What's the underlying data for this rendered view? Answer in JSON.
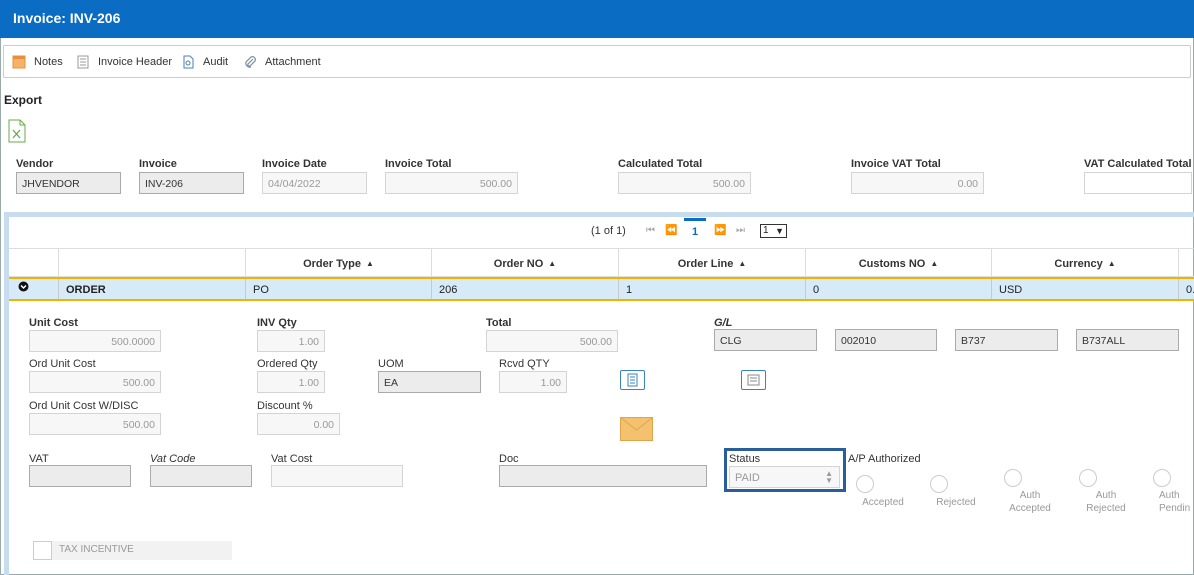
{
  "window": {
    "title": "Invoice: INV-206"
  },
  "toolbar": {
    "notes": "Notes",
    "invoice_header": "Invoice Header",
    "audit": "Audit",
    "attachment": "Attachment"
  },
  "export": {
    "label": "Export"
  },
  "header": {
    "vendor_label": "Vendor",
    "vendor_value": "JHVENDOR",
    "invoice_label": "Invoice",
    "invoice_value": "INV-206",
    "invoice_date_label": "Invoice Date",
    "invoice_date_value": "04/04/2022",
    "invoice_total_label": "Invoice Total",
    "invoice_total_value": "500.00",
    "calculated_total_label": "Calculated Total",
    "calculated_total_value": "500.00",
    "invoice_vat_total_label": "Invoice VAT Total",
    "invoice_vat_total_value": "0.00",
    "vat_calculated_total_label": "VAT Calculated Total",
    "vat_calculated_total_value": ""
  },
  "pager": {
    "summary": "(1 of 1)",
    "current_page": "1",
    "rows_per_page": "1"
  },
  "table": {
    "columns": [
      "Order Type",
      "Order NO",
      "Order Line",
      "Customs NO",
      "Currency"
    ],
    "row": {
      "label": "ORDER",
      "order_type": "PO",
      "order_no": "206",
      "order_line": "1",
      "customs_no": "0",
      "currency": "USD",
      "overflow": "0."
    }
  },
  "detail": {
    "unit_cost_label": "Unit Cost",
    "unit_cost_value": "500.0000",
    "inv_qty_label": "INV Qty",
    "inv_qty_value": "1.00",
    "total_label": "Total",
    "total_value": "500.00",
    "gl_label": "G/L",
    "gl_values": [
      "CLG",
      "002010",
      "B737",
      "B737ALL"
    ],
    "ord_unit_cost_label": "Ord Unit Cost",
    "ord_unit_cost_value": "500.00",
    "ordered_qty_label": "Ordered Qty",
    "ordered_qty_value": "1.00",
    "uom_label": "UOM",
    "uom_value": "EA",
    "rcvd_qty_label": "Rcvd QTY",
    "rcvd_qty_value": "1.00",
    "ord_unit_cost_disc_label": "Ord Unit Cost W/DISC",
    "ord_unit_cost_disc_value": "500.00",
    "discount_label": "Discount %",
    "discount_value": "0.00",
    "vat_label": "VAT",
    "vat_value": "",
    "vat_code_label": "Vat Code",
    "vat_code_value": "",
    "vat_cost_label": "Vat Cost",
    "vat_cost_value": "",
    "doc_label": "Doc",
    "doc_value": "",
    "status_label": "Status",
    "status_value": "PAID",
    "ap_authorized_label": "A/P Authorized",
    "radio_options": [
      "Accepted",
      "Rejected",
      "Auth\nAccepted",
      "Auth\nRejected",
      "Auth\nPendin"
    ],
    "tax_incentive_label": "TAX INCENTIVE"
  },
  "icons": {
    "notes": "notes-icon",
    "invoice_header": "invoice-header-icon",
    "audit": "audit-icon",
    "attachment": "paperclip-icon",
    "export": "excel-icon",
    "expand": "chevron-down-icon",
    "sort": "sort-icon",
    "envelope": "envelope-icon"
  },
  "colors": {
    "title_bar": "#0a6cc2",
    "selected_row": "#d6ebf7",
    "row_border": "#f0b400",
    "status_highlight": "#2a5e9b"
  }
}
